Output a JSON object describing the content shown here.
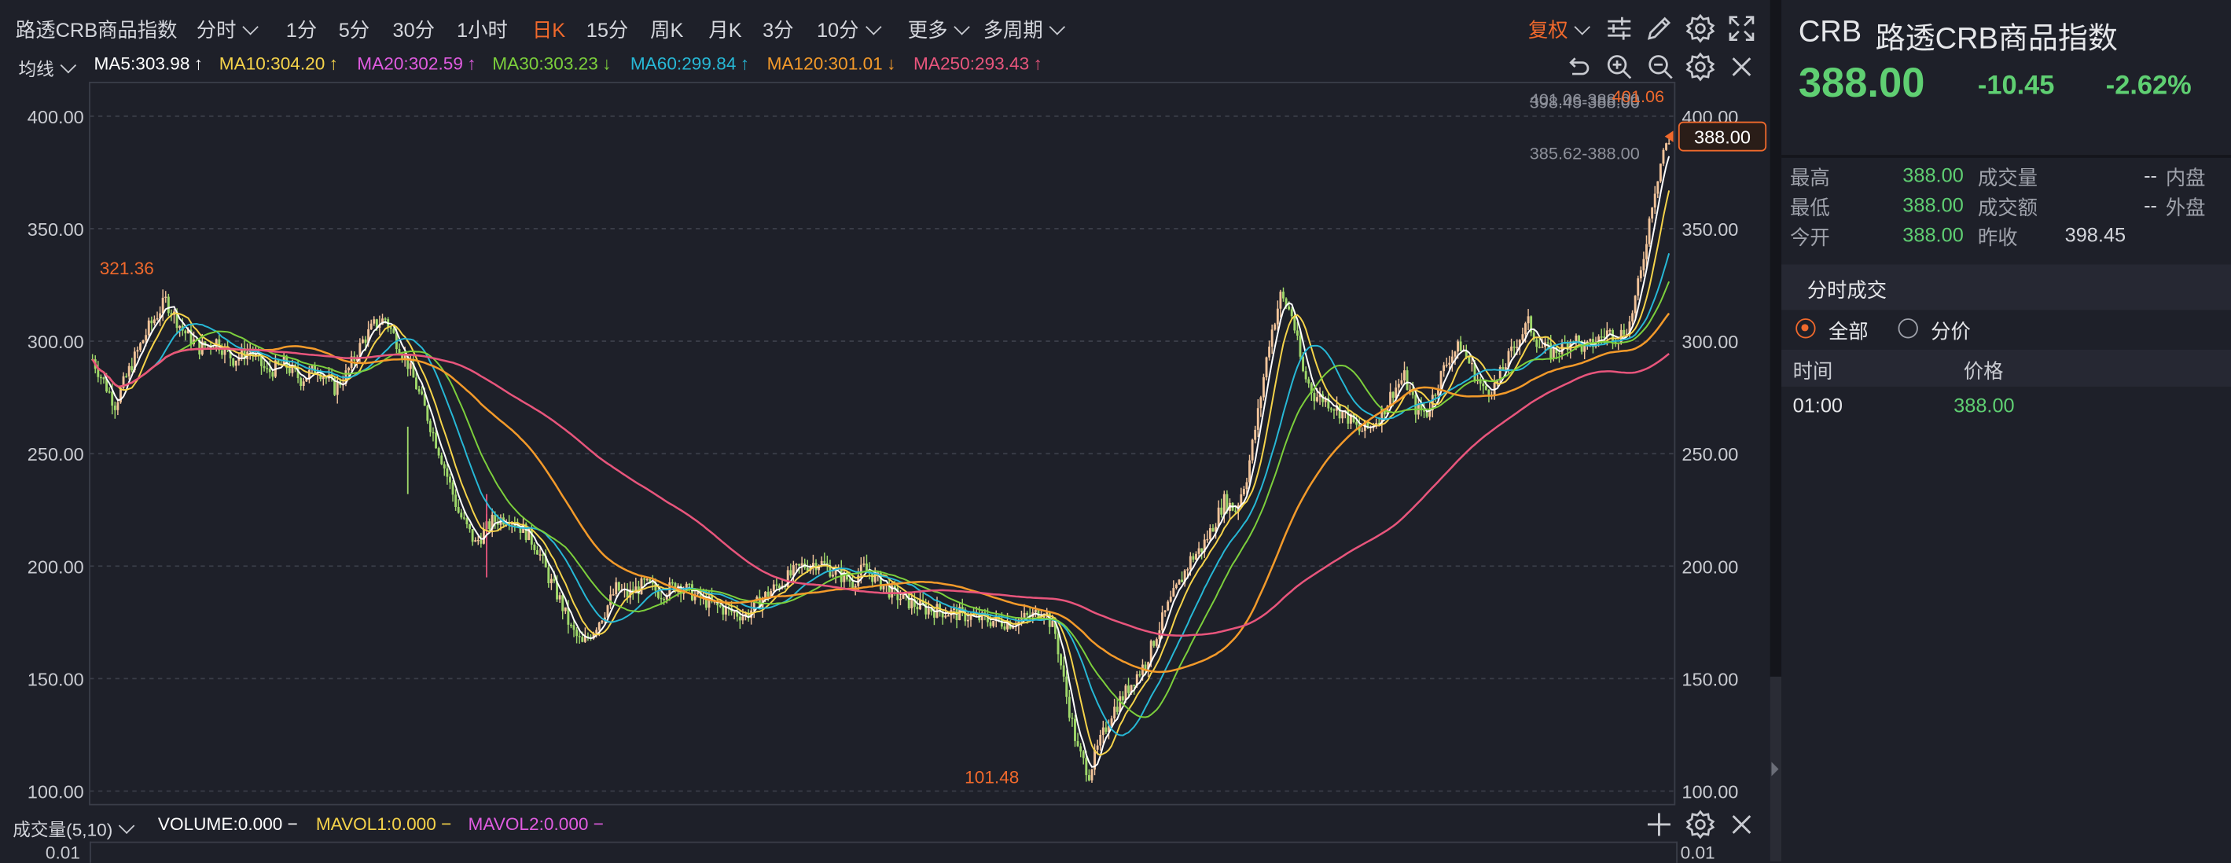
{
  "toolbar": {
    "title": "路透CRB商品指数",
    "intraday": "分时",
    "m1": "1分",
    "m5": "5分",
    "m30": "30分",
    "h1": "1小时",
    "daily": "日K",
    "m15": "15分",
    "weekly": "周K",
    "monthly": "月K",
    "m3": "3分",
    "m10": "10分",
    "more": "更多",
    "multi": "多周期",
    "adjust": "复权"
  },
  "ma_row": {
    "label": "均线",
    "items": [
      {
        "text": "MA5:303.98",
        "color": "#ffffff",
        "dir": "up"
      },
      {
        "text": "MA10:304.20",
        "color": "#f5d34a",
        "dir": "up"
      },
      {
        "text": "MA20:302.59",
        "color": "#e05ce0",
        "dir": "up"
      },
      {
        "text": "MA30:303.23",
        "color": "#7ccf3c",
        "dir": "down"
      },
      {
        "text": "MA60:299.84",
        "color": "#27b8d6",
        "dir": "up"
      },
      {
        "text": "MA120:301.01",
        "color": "#f39a2a",
        "dir": "down"
      },
      {
        "text": "MA250:293.43",
        "color": "#e8557c",
        "dir": "up"
      }
    ]
  },
  "chart_data": {
    "type": "candlestick",
    "y_ticks": [
      100,
      150,
      200,
      250,
      300,
      350,
      400
    ],
    "y_tick_labels": [
      "100.00",
      "150.00",
      "200.00",
      "250.00",
      "300.00",
      "350.00",
      "400.00"
    ],
    "ylim": [
      94,
      415
    ],
    "current_price_label": "388.00",
    "current_price": 388,
    "high_marker": "321.36",
    "high_value": 321.36,
    "low_marker": "101.48",
    "low_value": 101.48,
    "last_high_marker": "401.06",
    "annotation_1": "401.06-388.00",
    "annotation_2": "398.45-388.00",
    "annotation_3": "385.62-388.00",
    "trend_points": [
      [
        0,
        292
      ],
      [
        8,
        272
      ],
      [
        14,
        290
      ],
      [
        20,
        306
      ],
      [
        26,
        318
      ],
      [
        32,
        305
      ],
      [
        38,
        297
      ],
      [
        44,
        300
      ],
      [
        50,
        292
      ],
      [
        56,
        296
      ],
      [
        62,
        286
      ],
      [
        68,
        290
      ],
      [
        74,
        283
      ],
      [
        80,
        288
      ],
      [
        86,
        279
      ],
      [
        90,
        285
      ],
      [
        96,
        300
      ],
      [
        100,
        307
      ],
      [
        104,
        310
      ],
      [
        108,
        300
      ],
      [
        112,
        290
      ],
      [
        118,
        270
      ],
      [
        124,
        248
      ],
      [
        130,
        224
      ],
      [
        136,
        210
      ],
      [
        142,
        220
      ],
      [
        148,
        222
      ],
      [
        154,
        215
      ],
      [
        158,
        208
      ],
      [
        162,
        195
      ],
      [
        166,
        185
      ],
      [
        170,
        172
      ],
      [
        174,
        165
      ],
      [
        178,
        172
      ],
      [
        182,
        180
      ],
      [
        186,
        190
      ],
      [
        190,
        187
      ],
      [
        196,
        192
      ],
      [
        202,
        188
      ],
      [
        208,
        192
      ],
      [
        214,
        187
      ],
      [
        220,
        183
      ],
      [
        226,
        180
      ],
      [
        232,
        178
      ],
      [
        236,
        183
      ],
      [
        240,
        188
      ],
      [
        246,
        194
      ],
      [
        252,
        200
      ],
      [
        258,
        202
      ],
      [
        264,
        197
      ],
      [
        270,
        193
      ],
      [
        274,
        199
      ],
      [
        278,
        195
      ],
      [
        284,
        188
      ],
      [
        290,
        184
      ],
      [
        296,
        181
      ],
      [
        302,
        180
      ],
      [
        310,
        178
      ],
      [
        318,
        176
      ],
      [
        326,
        175
      ],
      [
        334,
        178
      ],
      [
        338,
        181
      ],
      [
        342,
        170
      ],
      [
        346,
        142
      ],
      [
        350,
        118
      ],
      [
        354,
        108
      ],
      [
        358,
        122
      ],
      [
        362,
        135
      ],
      [
        366,
        142
      ],
      [
        370,
        150
      ],
      [
        374,
        157
      ],
      [
        378,
        170
      ],
      [
        382,
        182
      ],
      [
        386,
        192
      ],
      [
        390,
        203
      ],
      [
        394,
        208
      ],
      [
        398,
        218
      ],
      [
        402,
        229
      ],
      [
        406,
        225
      ],
      [
        410,
        240
      ],
      [
        414,
        268
      ],
      [
        418,
        300
      ],
      [
        422,
        320
      ],
      [
        426,
        312
      ],
      [
        430,
        286
      ],
      [
        434,
        276
      ],
      [
        438,
        274
      ],
      [
        442,
        270
      ],
      [
        446,
        266
      ],
      [
        450,
        260
      ],
      [
        454,
        262
      ],
      [
        458,
        268
      ],
      [
        462,
        278
      ],
      [
        466,
        284
      ],
      [
        470,
        270
      ],
      [
        474,
        268
      ],
      [
        478,
        282
      ],
      [
        482,
        293
      ],
      [
        486,
        298
      ],
      [
        490,
        288
      ],
      [
        494,
        278
      ],
      [
        498,
        280
      ],
      [
        502,
        290
      ],
      [
        506,
        300
      ],
      [
        510,
        308
      ],
      [
        514,
        298
      ],
      [
        518,
        295
      ],
      [
        522,
        297
      ],
      [
        526,
        302
      ],
      [
        530,
        296
      ],
      [
        534,
        300
      ],
      [
        538,
        304
      ],
      [
        542,
        302
      ],
      [
        546,
        308
      ],
      [
        550,
        330
      ],
      [
        554,
        362
      ],
      [
        558,
        385
      ],
      [
        560,
        388
      ]
    ]
  },
  "volume": {
    "label": "成交量(5,10)",
    "volume": "VOLUME:0.000",
    "mavol1": "MAVOL1:0.000",
    "mavol2": "MAVOL2:0.000",
    "axis_left": "0.01",
    "axis_right": "0.01"
  },
  "panel": {
    "code": "CRB",
    "name": "路透CRB商品指数",
    "price": "388.00",
    "change": "-10.45",
    "change_pct": "-2.62%",
    "rows": [
      {
        "l1": "最高",
        "v1": "388.00",
        "l2": "成交量",
        "v2": "--",
        "l3": "内盘"
      },
      {
        "l1": "最低",
        "v1": "388.00",
        "l2": "成交额",
        "v2": "--",
        "l3": "外盘"
      },
      {
        "l1": "今开",
        "v1": "388.00",
        "l2": "昨收",
        "v2": "398.45",
        "l3": ""
      }
    ],
    "section_title": "分时成交",
    "radio_all": "全部",
    "radio_price": "分价",
    "col_time": "时间",
    "col_price": "价格",
    "trades": [
      {
        "time": "01:00",
        "price": "388.00"
      }
    ]
  }
}
